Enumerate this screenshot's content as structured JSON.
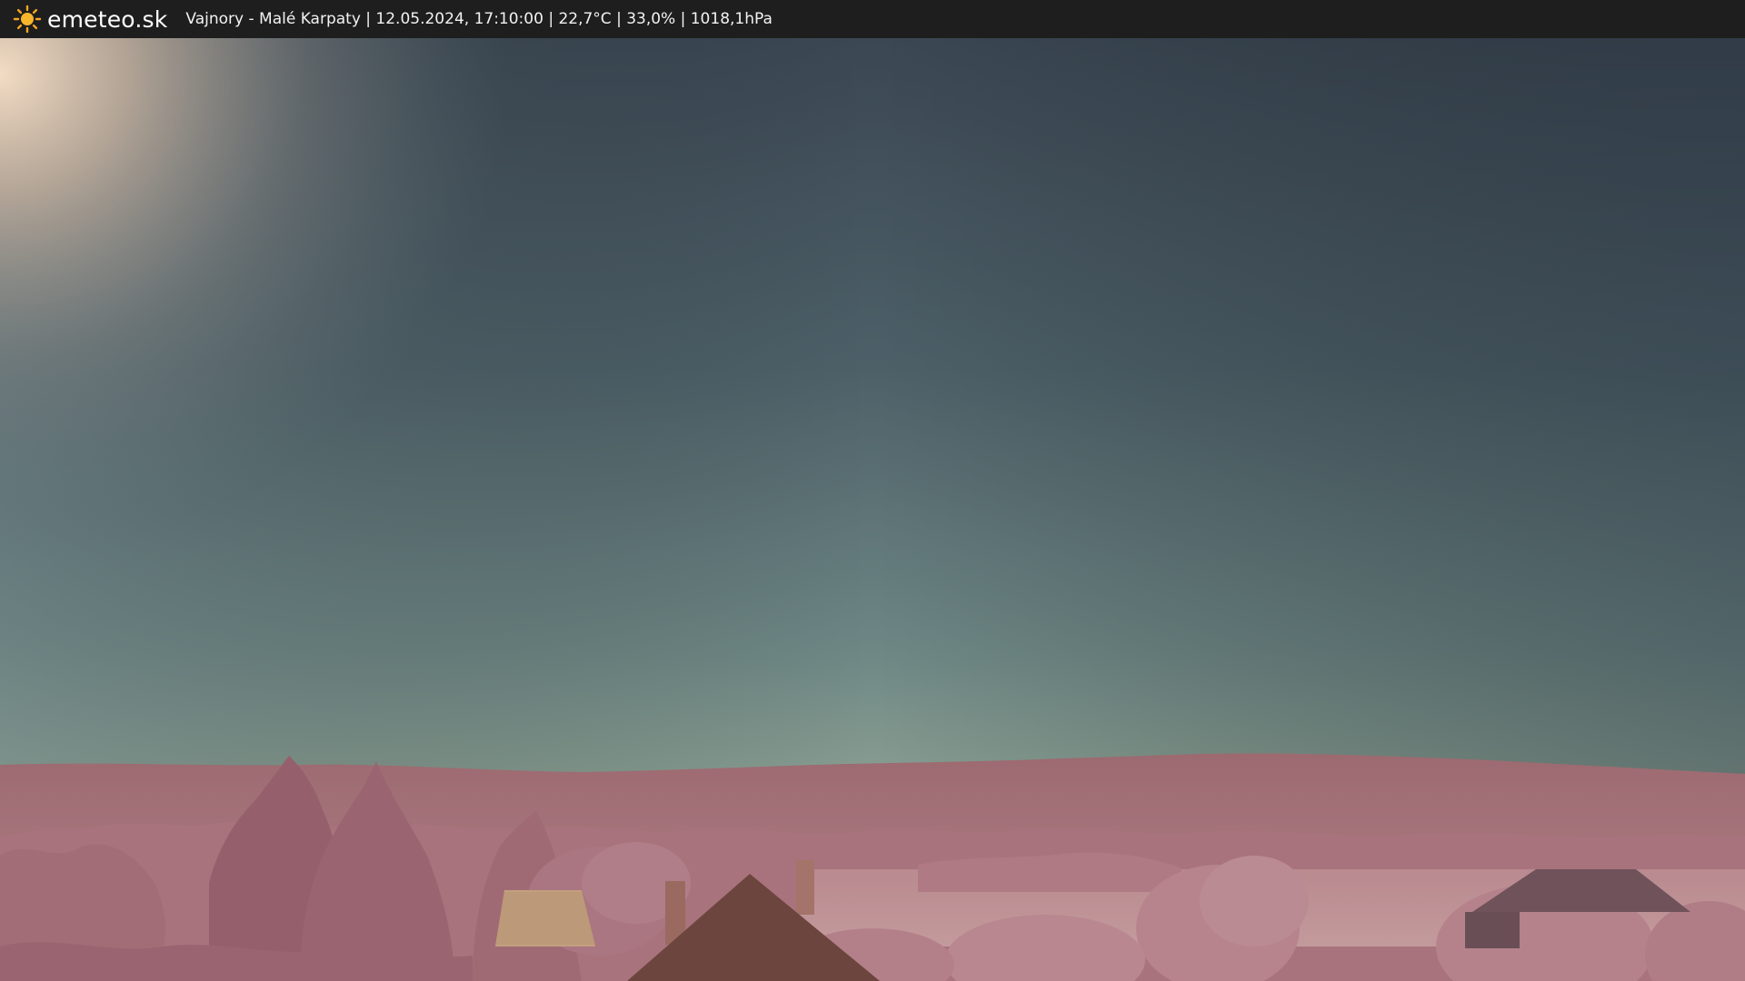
{
  "header": {
    "logo_icon": "sun-icon",
    "brand": "emeteo.sk",
    "caption": "Vajnory - Malé Karpaty | 12.05.2024, 17:10:00 | 22,7°C | 33,0% | 1018,1hPa"
  },
  "colors": {
    "header_bg": "#1e1e1e",
    "sun": "#f5a623",
    "sky_top": "#3a4652",
    "sky_horizon": "#93a89a",
    "vegetation": "#b37a86"
  }
}
